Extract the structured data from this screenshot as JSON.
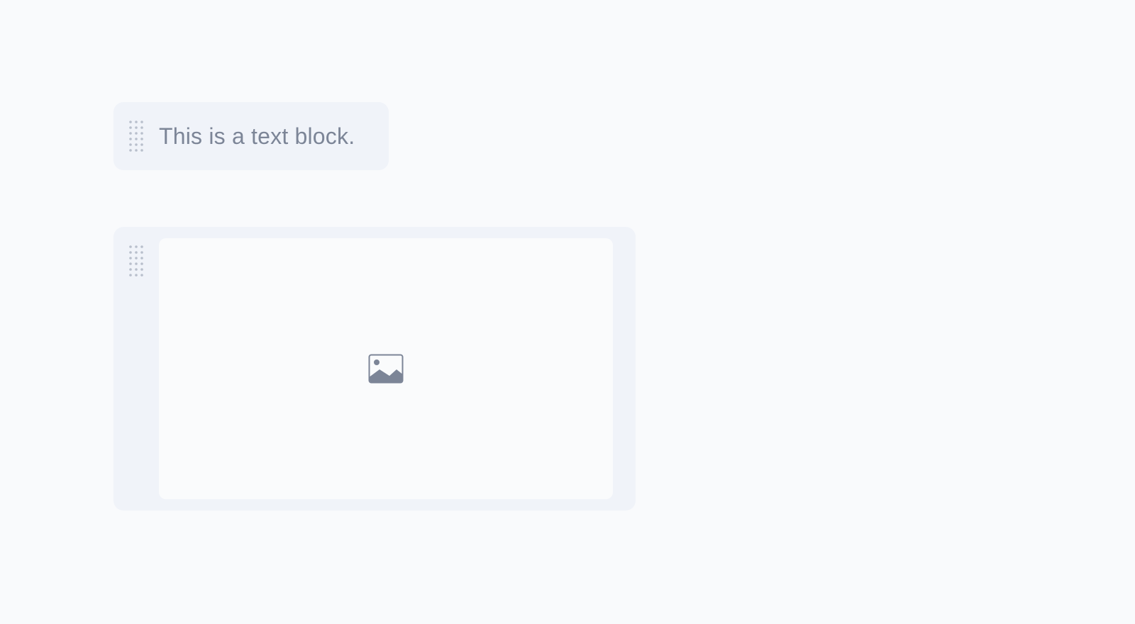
{
  "blocks": [
    {
      "type": "text",
      "text": "This is a text block.",
      "handle_icon": "drag-handle-icon"
    },
    {
      "type": "image",
      "placeholder_icon": "image-placeholder-icon",
      "handle_icon": "drag-handle-icon"
    }
  ],
  "colors": {
    "background": "#f9fafc",
    "block_background": "#f0f3f9",
    "text": "#7c8597",
    "handle_dots": "#b8bfcc",
    "image_frame": "#fafbfc",
    "image_icon": "#7c8597"
  }
}
